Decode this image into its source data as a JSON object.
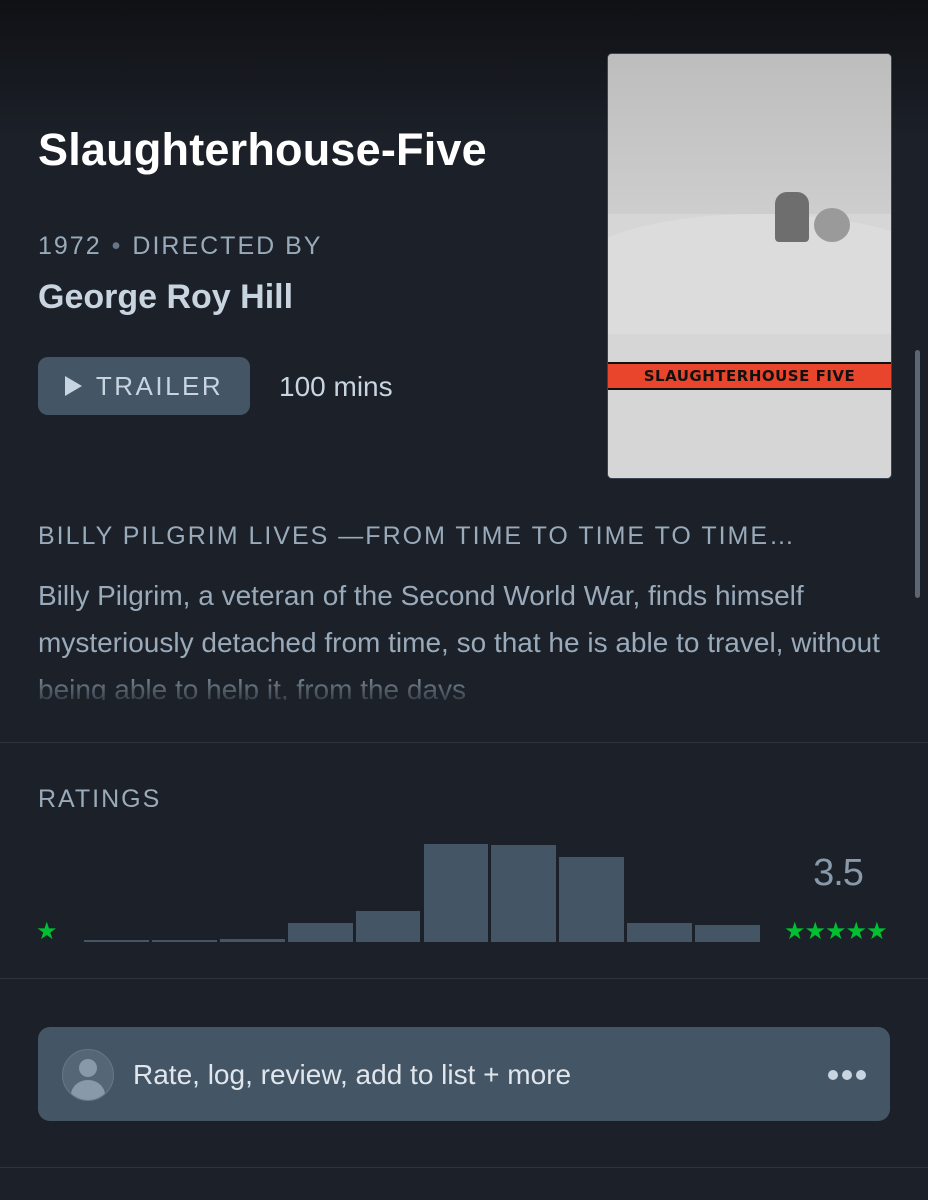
{
  "film": {
    "title": "Slaughterhouse-Five",
    "year": "1972",
    "directed_by_label": "DIRECTED BY",
    "director": "George Roy Hill",
    "trailer_label": "TRAILER",
    "runtime": "100 mins",
    "poster_banner_text": "SLAUGHTERHOUSE FIVE",
    "tagline": "BILLY PILGRIM LIVES —FROM TIME TO TIME TO TIME…",
    "synopsis": "Billy Pilgrim, a veteran of the Second World War, finds himself mysteriously detached from time, so that he is able to travel, without being able to help it, from the days"
  },
  "ratings": {
    "label": "RATINGS",
    "average": "3.5",
    "min_stars": "★",
    "max_stars": "★★★★★",
    "star_color": "#00c030",
    "bar_color": "#445566",
    "histogram_levels": [
      0.02,
      0.02,
      0.03,
      0.19,
      0.3,
      0.96,
      0.95,
      0.83,
      0.19,
      0.17
    ]
  },
  "action_bar": {
    "label": "Rate, log, review, add to list + more",
    "avatar_icon": "user-avatar-icon",
    "more_icon": "ellipsis-icon"
  },
  "colors": {
    "background": "#1c2028",
    "text_muted": "#99aabb",
    "button": "#445566"
  }
}
